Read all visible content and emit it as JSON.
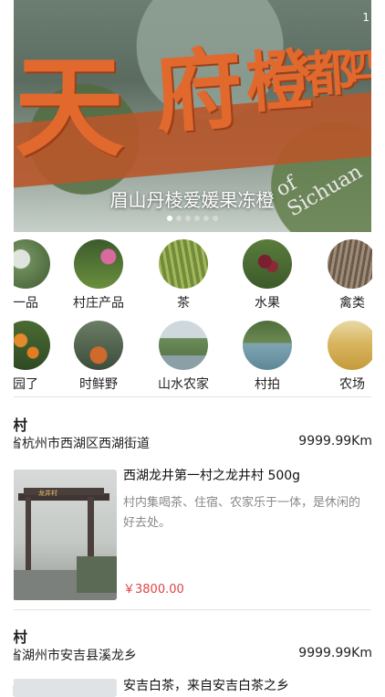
{
  "banner": {
    "caption": "眉山丹棱爱媛果冻橙",
    "page_indicator": "1",
    "slide_count": 6,
    "active_slide": 1,
    "sign_chars": [
      "天",
      "府",
      "橙",
      "都",
      "四"
    ],
    "sign_english": "of Sichuan"
  },
  "categories_row1": [
    {
      "label": "一品",
      "icon": "produce-photo-icon"
    },
    {
      "label": "村庄产品",
      "icon": "farmer-photo-icon"
    },
    {
      "label": "茶",
      "icon": "tea-field-photo-icon"
    },
    {
      "label": "水果",
      "icon": "fruit-tree-photo-icon"
    },
    {
      "label": "禽类",
      "icon": "poultry-photo-icon"
    }
  ],
  "categories_row2": [
    {
      "label": "园了",
      "icon": "orange-tree-photo-icon"
    },
    {
      "label": "时鲜野",
      "icon": "fishing-photo-icon"
    },
    {
      "label": "山水农家",
      "icon": "landscape-photo-icon"
    },
    {
      "label": "村拍",
      "icon": "village-river-photo-icon"
    },
    {
      "label": "农场",
      "icon": "farm-harvest-photo-icon"
    }
  ],
  "listings": [
    {
      "village": "村",
      "address": "省杭州市西湖区西湖街道",
      "distance": "9999.99Km",
      "product_title": "西湖龙井第一村之龙井村    500g",
      "description": "村内集喝茶、住宿、农家乐于一体，是休闲的好去处。",
      "price": "￥3800.00",
      "gate_text": "龙井村"
    },
    {
      "village": "村",
      "address": "省湖州市安吉县溪龙乡",
      "distance": "9999.99Km",
      "product_title": "安吉白茶，来自安吉白茶之乡"
    }
  ]
}
